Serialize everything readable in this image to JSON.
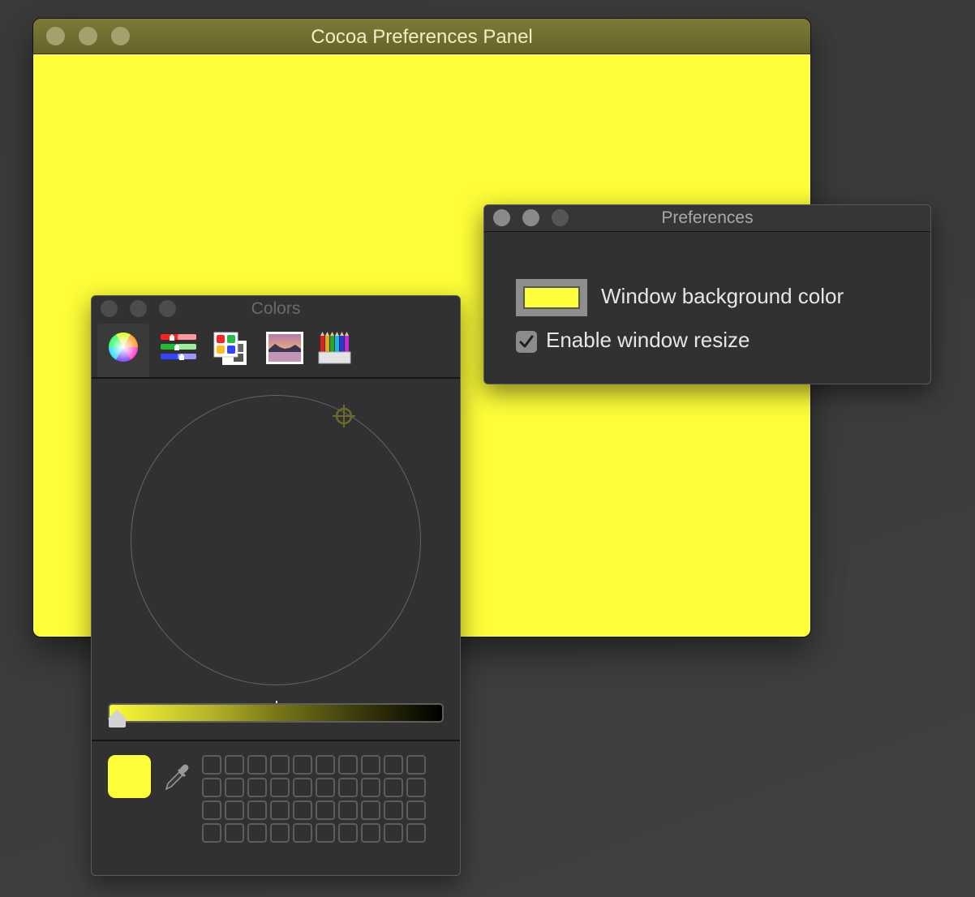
{
  "main_window": {
    "title": "Cocoa Preferences Panel",
    "background_color": "#fdfd39",
    "titlebar_tint": "#73712f"
  },
  "preferences_window": {
    "title": "Preferences",
    "background_color_label": "Window background color",
    "background_color_value": "#fdfd39",
    "enable_resize_label": "Enable window resize",
    "enable_resize_checked": true
  },
  "colors_panel": {
    "title": "Colors",
    "modes": [
      {
        "name": "color-wheel",
        "selected": true
      },
      {
        "name": "color-sliders",
        "selected": false
      },
      {
        "name": "color-palettes",
        "selected": false
      },
      {
        "name": "image-palettes",
        "selected": false
      },
      {
        "name": "pencils",
        "selected": false
      }
    ],
    "selected_color": "#fdfd39",
    "brightness": 1.0,
    "swatch_rows": 4,
    "swatch_columns": 10
  },
  "icons": {
    "traffic_close": "close-button-icon",
    "traffic_minimize": "minimize-button-icon",
    "traffic_zoom": "zoom-button-icon",
    "eyedropper": "eyedropper-icon",
    "checkmark": "checkmark-icon"
  }
}
